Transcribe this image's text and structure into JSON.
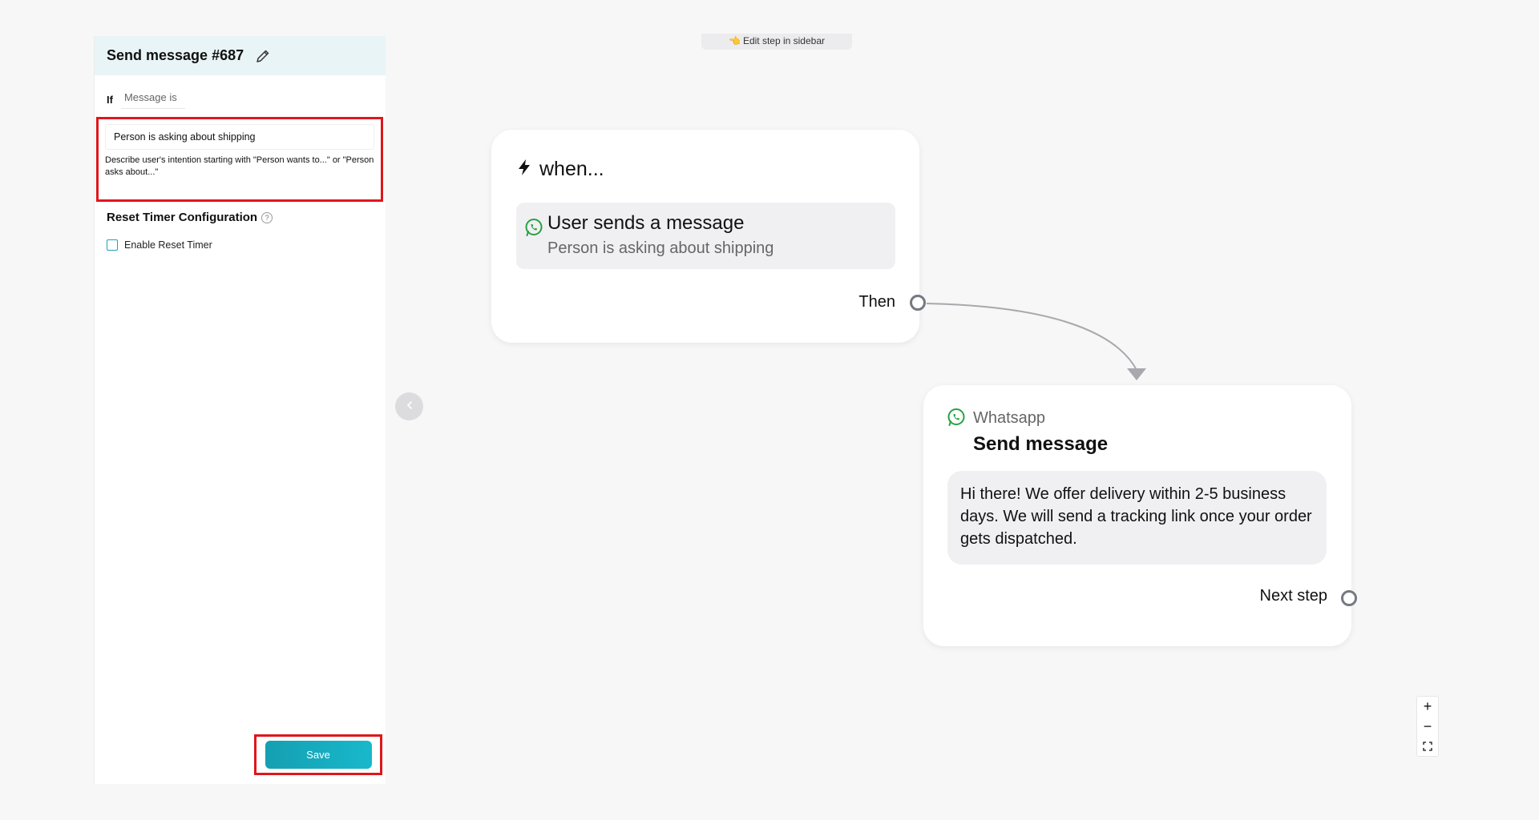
{
  "top_hint": {
    "icon": "pointing-hand-icon",
    "text": "Edit step in sidebar"
  },
  "sidebar": {
    "title": "Send message #687",
    "condition": {
      "if_label": "If",
      "type": "Message is",
      "value": "Person is asking about shipping",
      "help": "Describe user's intention starting with \"Person wants to...\" or \"Person asks about...\""
    },
    "reset_timer": {
      "title": "Reset Timer Configuration",
      "help_glyph": "?",
      "checkbox_label": "Enable Reset Timer",
      "checked": false
    },
    "save_label": "Save"
  },
  "canvas": {
    "trigger": {
      "title": "when...",
      "event": "User sends a message",
      "condition": "Person is asking about shipping",
      "then_label": "Then"
    },
    "action": {
      "channel": "Whatsapp",
      "title": "Send message",
      "message": "Hi there! We offer delivery within 2-5 business days. We will send a tracking link once your order gets dispatched.",
      "next_label": "Next step"
    },
    "zoom": {
      "in": "+",
      "out": "−"
    }
  },
  "colors": {
    "accent": "#18b3c6",
    "highlight": "#e0161b",
    "whatsapp": "#25a244",
    "card_inner": "#f0f0f2"
  }
}
